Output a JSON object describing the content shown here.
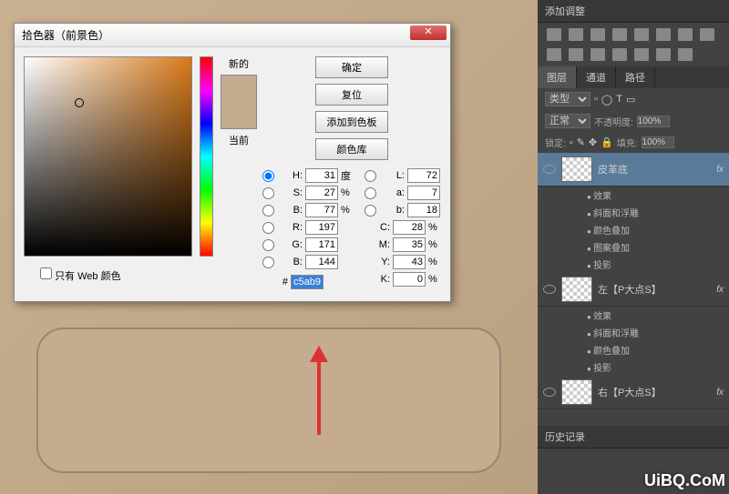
{
  "dialog": {
    "title": "拾色器（前景色）",
    "new_label": "新的",
    "current_label": "当前",
    "buttons": {
      "ok": "确定",
      "reset": "复位",
      "add_swatch": "添加到色板",
      "color_lib": "颜色库"
    },
    "hsb": {
      "h": "31",
      "h_unit": "度",
      "s": "27",
      "b": "77"
    },
    "lab": {
      "l": "72",
      "a": "7",
      "b": "18"
    },
    "rgb": {
      "r": "197",
      "g": "171",
      "b": "144"
    },
    "cmyk": {
      "c": "28",
      "m": "35",
      "y": "43",
      "k": "0"
    },
    "hex": "c5ab90",
    "web_only": "只有 Web 颜色"
  },
  "panels": {
    "adjustments_title": "添加调整",
    "tabs": {
      "layers": "图层",
      "channels": "通道",
      "paths": "路径"
    },
    "type_label": "类型",
    "blend_mode": "正常",
    "opacity_label": "不透明度:",
    "opacity_value": "100%",
    "lock_label": "锁定:",
    "fill_label": "填充:",
    "fill_value": "100%",
    "history_label": "历史记录"
  },
  "layers": [
    {
      "name": "皮革底",
      "fx": "fx",
      "effects_label": "效果",
      "effects": [
        "斜面和浮雕",
        "颜色叠加",
        "图案叠加",
        "投影"
      ]
    },
    {
      "name": "左【P大点S】",
      "fx": "fx",
      "effects_label": "效果",
      "effects": [
        "斜面和浮雕",
        "颜色叠加",
        "投影"
      ]
    },
    {
      "name": "右【P大点S】",
      "fx": "fx",
      "effects_label": "",
      "effects": []
    }
  ],
  "watermark": "UiBQ.CoM"
}
